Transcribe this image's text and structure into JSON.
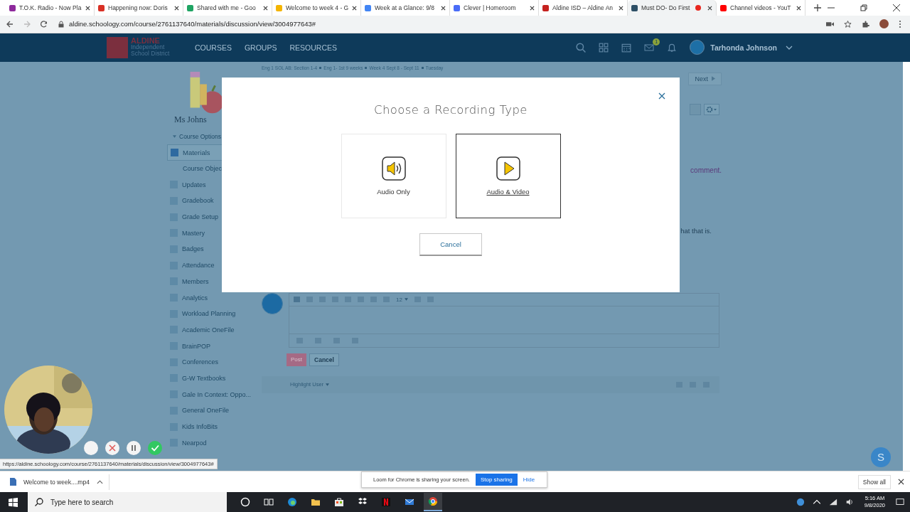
{
  "browser": {
    "tabs": [
      {
        "title": "T.O.K. Radio - Now Pla",
        "color": "#8e2a9c",
        "selected": false,
        "recording": false
      },
      {
        "title": "Happening now: Doris",
        "color": "#d93025",
        "selected": false,
        "recording": false
      },
      {
        "title": "Shared with me - Goo",
        "color": "#1fa463",
        "selected": false,
        "recording": false
      },
      {
        "title": "Welcome to week 4 - G",
        "color": "#f4b400",
        "selected": false,
        "recording": false
      },
      {
        "title": "Week at a Glance: 9/8",
        "color": "#4285f4",
        "selected": false,
        "recording": false
      },
      {
        "title": "Clever | Homeroom",
        "color": "#4a6cf7",
        "selected": false,
        "recording": false
      },
      {
        "title": "Aldine ISD – Aldine An",
        "color": "#c5221f",
        "selected": false,
        "recording": false
      },
      {
        "title": "Must DO- Do First",
        "color": "#2d4f66",
        "selected": true,
        "recording": true
      },
      {
        "title": "Channel videos - YouT",
        "color": "#ff0000",
        "selected": false,
        "recording": false
      }
    ],
    "url": "aldine.schoology.com/course/2761137640/materials/discussion/view/3004977643#"
  },
  "header": {
    "logo": [
      "ALDINE",
      "Independent",
      "School District"
    ],
    "nav": [
      "COURSES",
      "GROUPS",
      "RESOURCES"
    ],
    "mail_badge": "1",
    "user": "Tarhonda Johnson"
  },
  "sidebar": {
    "course_title": "Ms Johns",
    "options": "Course Options",
    "items": [
      {
        "label": "Materials",
        "selected": true,
        "children": [
          {
            "label": "Course Objec",
            "selected": false
          }
        ]
      },
      {
        "label": "Updates",
        "selected": false
      },
      {
        "label": "Gradebook",
        "selected": false
      },
      {
        "label": "Grade Setup",
        "selected": false
      },
      {
        "label": "Mastery",
        "selected": false
      },
      {
        "label": "Badges",
        "selected": false
      },
      {
        "label": "Attendance",
        "selected": false
      },
      {
        "label": "Members",
        "selected": false
      },
      {
        "label": "Analytics",
        "selected": false
      },
      {
        "label": "Workload Planning",
        "selected": false
      },
      {
        "label": "Academic OneFile",
        "selected": false
      },
      {
        "label": "BrainPOP",
        "selected": false
      },
      {
        "label": "Conferences",
        "selected": false
      },
      {
        "label": "G-W Textbooks",
        "selected": false
      },
      {
        "label": "Gale In Context: Oppo...",
        "selected": false
      },
      {
        "label": "General OneFile",
        "selected": false
      },
      {
        "label": "Kids InfoBits",
        "selected": false
      },
      {
        "label": "Nearpod",
        "selected": false
      }
    ]
  },
  "main": {
    "breadcrumb": [
      "Eng 1 SOL AB: Section 1-4",
      "Eng 1- 1st 9 weeks",
      "Week 4 Sept 8 - Sept 11",
      "Tuesday"
    ],
    "next": "Next",
    "fragments": [
      {
        "text": "comment.",
        "kind": "link"
      },
      {
        "text": "hat that is.",
        "kind": "plain"
      }
    ],
    "editor": {
      "font_size": "12",
      "post": "Post",
      "cancel": "Cancel",
      "highlight": "Highlight User"
    }
  },
  "modal": {
    "title": "Choose a Recording Type",
    "options": [
      {
        "label": "Audio Only",
        "kind": "audio",
        "selected": false
      },
      {
        "label": "Audio & Video",
        "kind": "video",
        "selected": true
      }
    ],
    "cancel": "Cancel"
  },
  "chat_bubble": "S",
  "status_url": "https://aldine.schoology.com/course/2761137640/materials/discussion/view/3004977643#",
  "downloads": {
    "file": "Welcome to week....mp4",
    "show_all": "Show all"
  },
  "loom": {
    "message": "Loom for Chrome is sharing your screen.",
    "stop": "Stop sharing",
    "hide": "Hide"
  },
  "taskbar": {
    "search_placeholder": "Type here to search",
    "time": "5:16 AM",
    "date": "9/8/2020"
  }
}
